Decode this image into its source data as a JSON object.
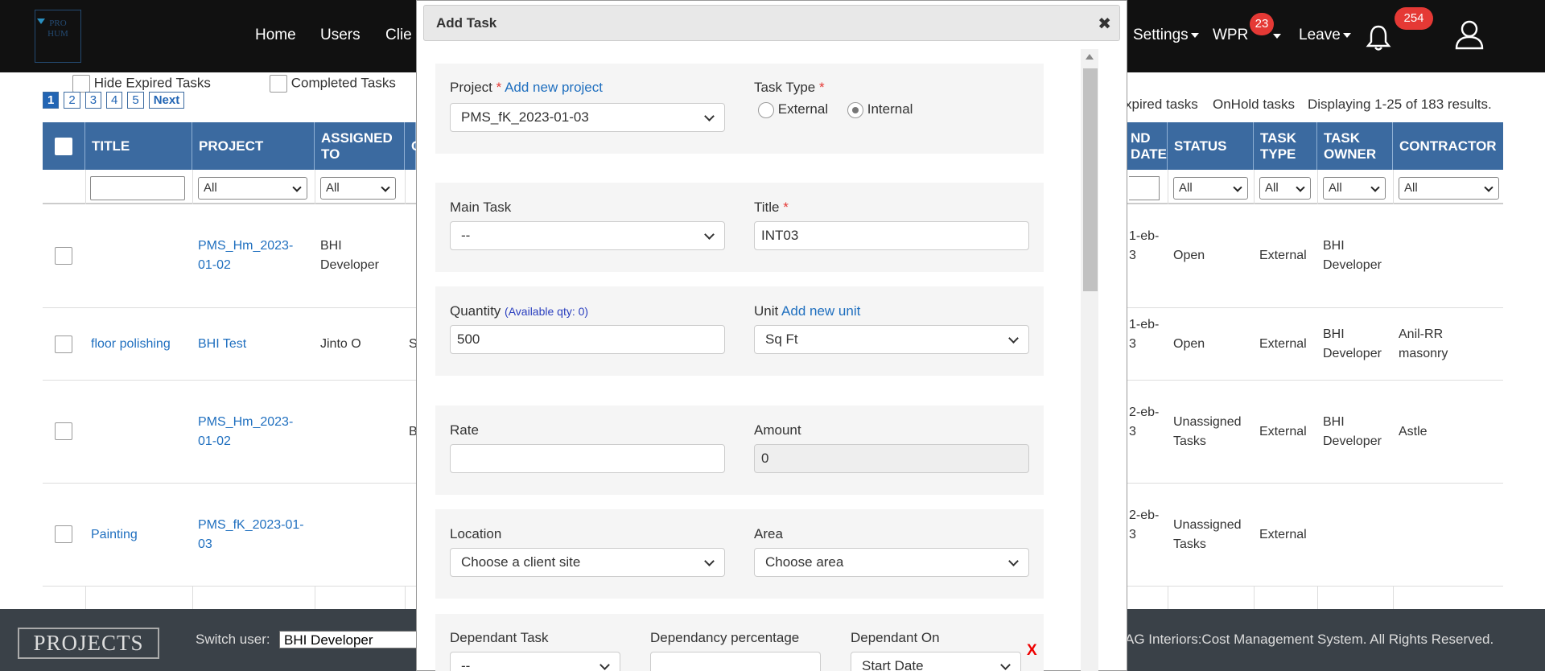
{
  "logo": {
    "text": "PRO HUM"
  },
  "nav": {
    "home": "Home",
    "users": "Users",
    "clients": "Clie",
    "settings": "Settings",
    "wpr": "WPR",
    "wpr_badge": "23",
    "leave": "Leave",
    "notif_badge": "254"
  },
  "filters": {
    "hide_expired": "Hide Expired Tasks",
    "completed": "Completed Tasks",
    "expired_tasks": "xpired tasks",
    "onhold_tasks": "OnHold tasks",
    "displaying": "Displaying 1-25 of 183 results."
  },
  "pager": [
    "1",
    "2",
    "3",
    "4",
    "5",
    "Next"
  ],
  "table": {
    "headers": {
      "title": "TITLE",
      "project": "PROJECT",
      "assigned": "ASSIGNED TO",
      "c": "C",
      "end_date": "ND DATE",
      "status": "STATUS",
      "task_type": "TASK TYPE",
      "task_owner": "TASK OWNER",
      "contractor": "CONTRACTOR"
    },
    "filter_all": "All",
    "rows": [
      {
        "title": "",
        "project": "PMS_Hm_2023-01-02",
        "assigned": "BHI Developer",
        "c": "",
        "end": "1-eb-3",
        "status": "Open",
        "type": "External",
        "owner": "BHI Developer",
        "contractor": ""
      },
      {
        "title": "floor polishing",
        "project": "BHI Test",
        "assigned": "Jinto O",
        "c": "S",
        "end": "1-eb-3",
        "status": "Open",
        "type": "External",
        "owner": "BHI Developer",
        "contractor": "Anil-RR masonry"
      },
      {
        "title": "",
        "project": "PMS_Hm_2023-01-02",
        "assigned": "",
        "c": "B",
        "end": "2-eb-3",
        "status": "Unassigned Tasks",
        "type": "External",
        "owner": "BHI Developer",
        "contractor": "Astle"
      },
      {
        "title": "Painting",
        "project": "PMS_fK_2023-01-03",
        "assigned": "",
        "c": "",
        "end": "2-eb-3",
        "status": "Unassigned Tasks",
        "type": "External",
        "owner": "",
        "contractor": ""
      }
    ]
  },
  "footer": {
    "projects": "PROJECTS",
    "switch_user": "Switch user:",
    "switch_value": "BHI Developer",
    "copyright": "AG Interiors:Cost Management System. All Rights Reserved."
  },
  "modal": {
    "title": "Add Task",
    "project_label": "Project",
    "add_project": "Add new project",
    "project_value": "PMS_fK_2023-01-03",
    "task_type_label": "Task Type",
    "external": "External",
    "internal": "Internal",
    "main_task_label": "Main Task",
    "main_task_value": "--",
    "title_label": "Title",
    "title_value": "INT03",
    "quantity_label": "Quantity",
    "available_qty": "(Available qty: 0)",
    "quantity_value": "500",
    "unit_label": "Unit",
    "add_unit": "Add new unit",
    "unit_value": "Sq Ft",
    "rate_label": "Rate",
    "rate_value": "",
    "amount_label": "Amount",
    "amount_value": "0",
    "location_label": "Location",
    "location_value": "Choose a client site",
    "area_label": "Area",
    "area_value": "Choose area",
    "dep_task_label": "Dependant Task",
    "dep_task_value": "--",
    "dep_pct_label": "Dependancy percentage",
    "dep_on_label": "Dependant On",
    "dep_on_value": "Start Date",
    "remove": "X"
  }
}
